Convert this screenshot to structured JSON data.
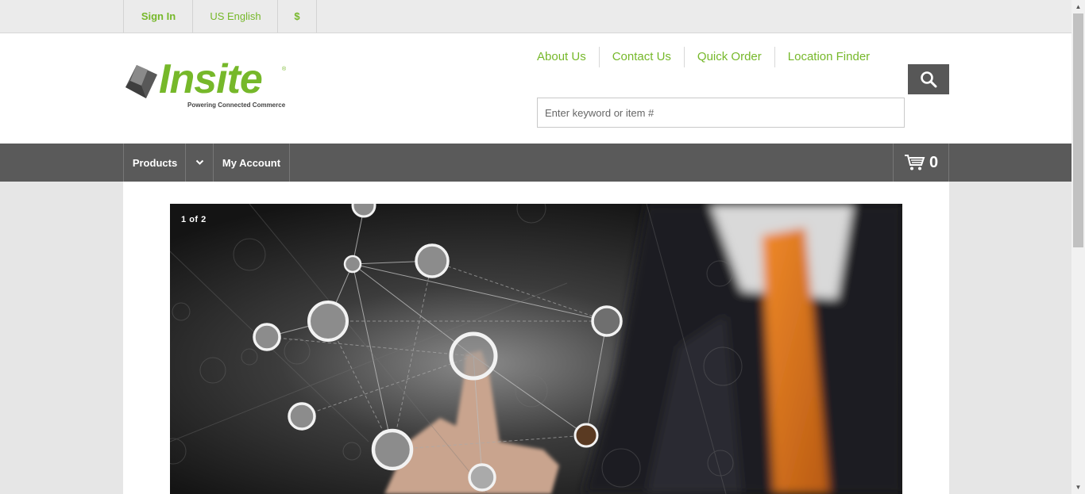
{
  "topbar": {
    "signin_label": "Sign In",
    "language_label": "US English",
    "currency_symbol": "$"
  },
  "brand": {
    "name": "Insite",
    "registered_mark": "®",
    "tagline": "Powering Connected Commerce",
    "accent_color": "#76b82a"
  },
  "utility_links": [
    "About Us",
    "Contact Us",
    "Quick Order",
    "Location Finder"
  ],
  "search": {
    "placeholder": "Enter keyword or item #",
    "value": "",
    "icon": "search-icon"
  },
  "nav": {
    "products_label": "Products",
    "toggle_icon": "chevron-down-icon",
    "account_label": "My Account",
    "cart_icon": "cart-icon",
    "cart_count": "0"
  },
  "hero": {
    "slide_current": "1",
    "slide_of": "of",
    "slide_total": "2"
  }
}
